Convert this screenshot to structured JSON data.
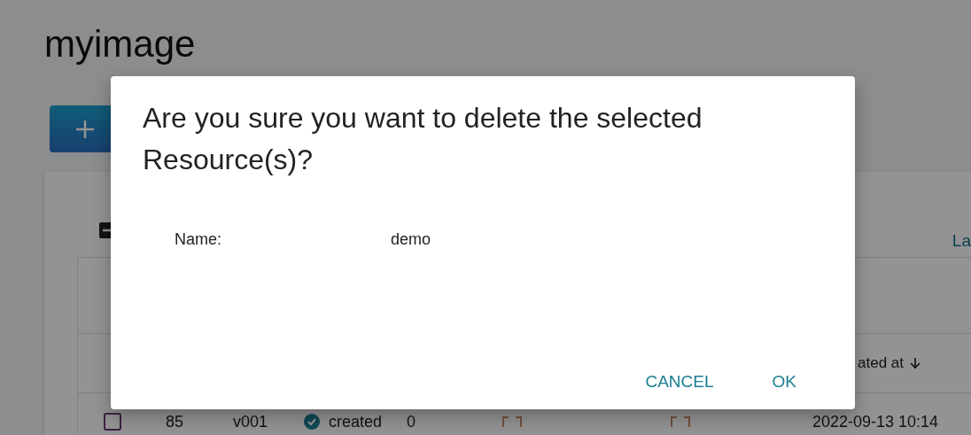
{
  "page": {
    "title": "myimage",
    "toolbar_link": "La",
    "table": {
      "sort_header": "ated at",
      "rows": [
        {
          "selected": false,
          "cells": [
            "85",
            "v001",
            "created",
            "0",
            "2022-09-13 10:14"
          ]
        }
      ]
    }
  },
  "dialog": {
    "title": "Are you sure you want to delete the selected Resource(s)?",
    "fields": [
      {
        "label": "Name:",
        "value": "demo"
      }
    ],
    "buttons": [
      "CANCEL",
      "OK"
    ]
  }
}
